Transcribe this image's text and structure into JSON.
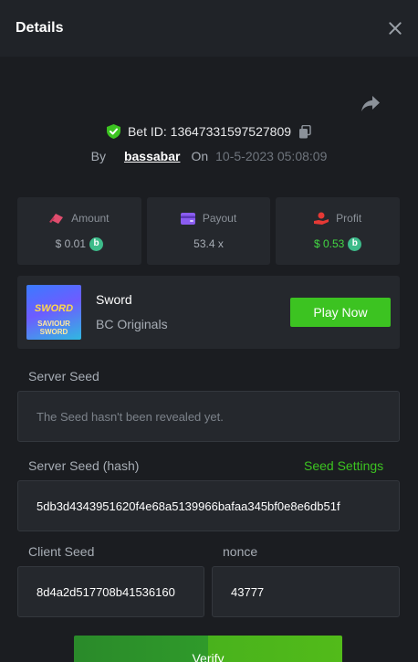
{
  "header": {
    "title": "Details"
  },
  "bet": {
    "id_text": "Bet ID: 136473315975278​09",
    "by_label": "By",
    "username": "bassabar",
    "on_label": "On",
    "date": "10-5-2023 05:08:09"
  },
  "stats": {
    "amount": {
      "label": "Amount",
      "value": "$ 0.01"
    },
    "payout": {
      "label": "Payout",
      "value": "53.4 x"
    },
    "profit": {
      "label": "Profit",
      "value": "$ 0.53"
    },
    "coin_letter": "b"
  },
  "game": {
    "name": "Sword",
    "provider": "BC Originals",
    "thumb_title": "SWORD",
    "thumb_subtitle": "SAVIOUR SWORD",
    "play_label": "Play Now"
  },
  "seeds": {
    "server_seed_label": "Server Seed",
    "server_seed_value": "The Seed hasn't been revealed yet.",
    "server_hash_label": "Server Seed (hash)",
    "seed_settings_label": "Seed Settings",
    "server_hash_value": "5db3d4343951620f4e68a5139966bafaa345bf0e8e6db51f",
    "client_seed_label": "Client Seed",
    "client_seed_value": "8d4a2d517708b41536160",
    "nonce_label": "nonce",
    "nonce_value": "43777"
  },
  "actions": {
    "verify_label": "Verify"
  },
  "colors": {
    "accent_green": "#3cc321",
    "panel": "#25282d",
    "background": "#1b1d21"
  }
}
